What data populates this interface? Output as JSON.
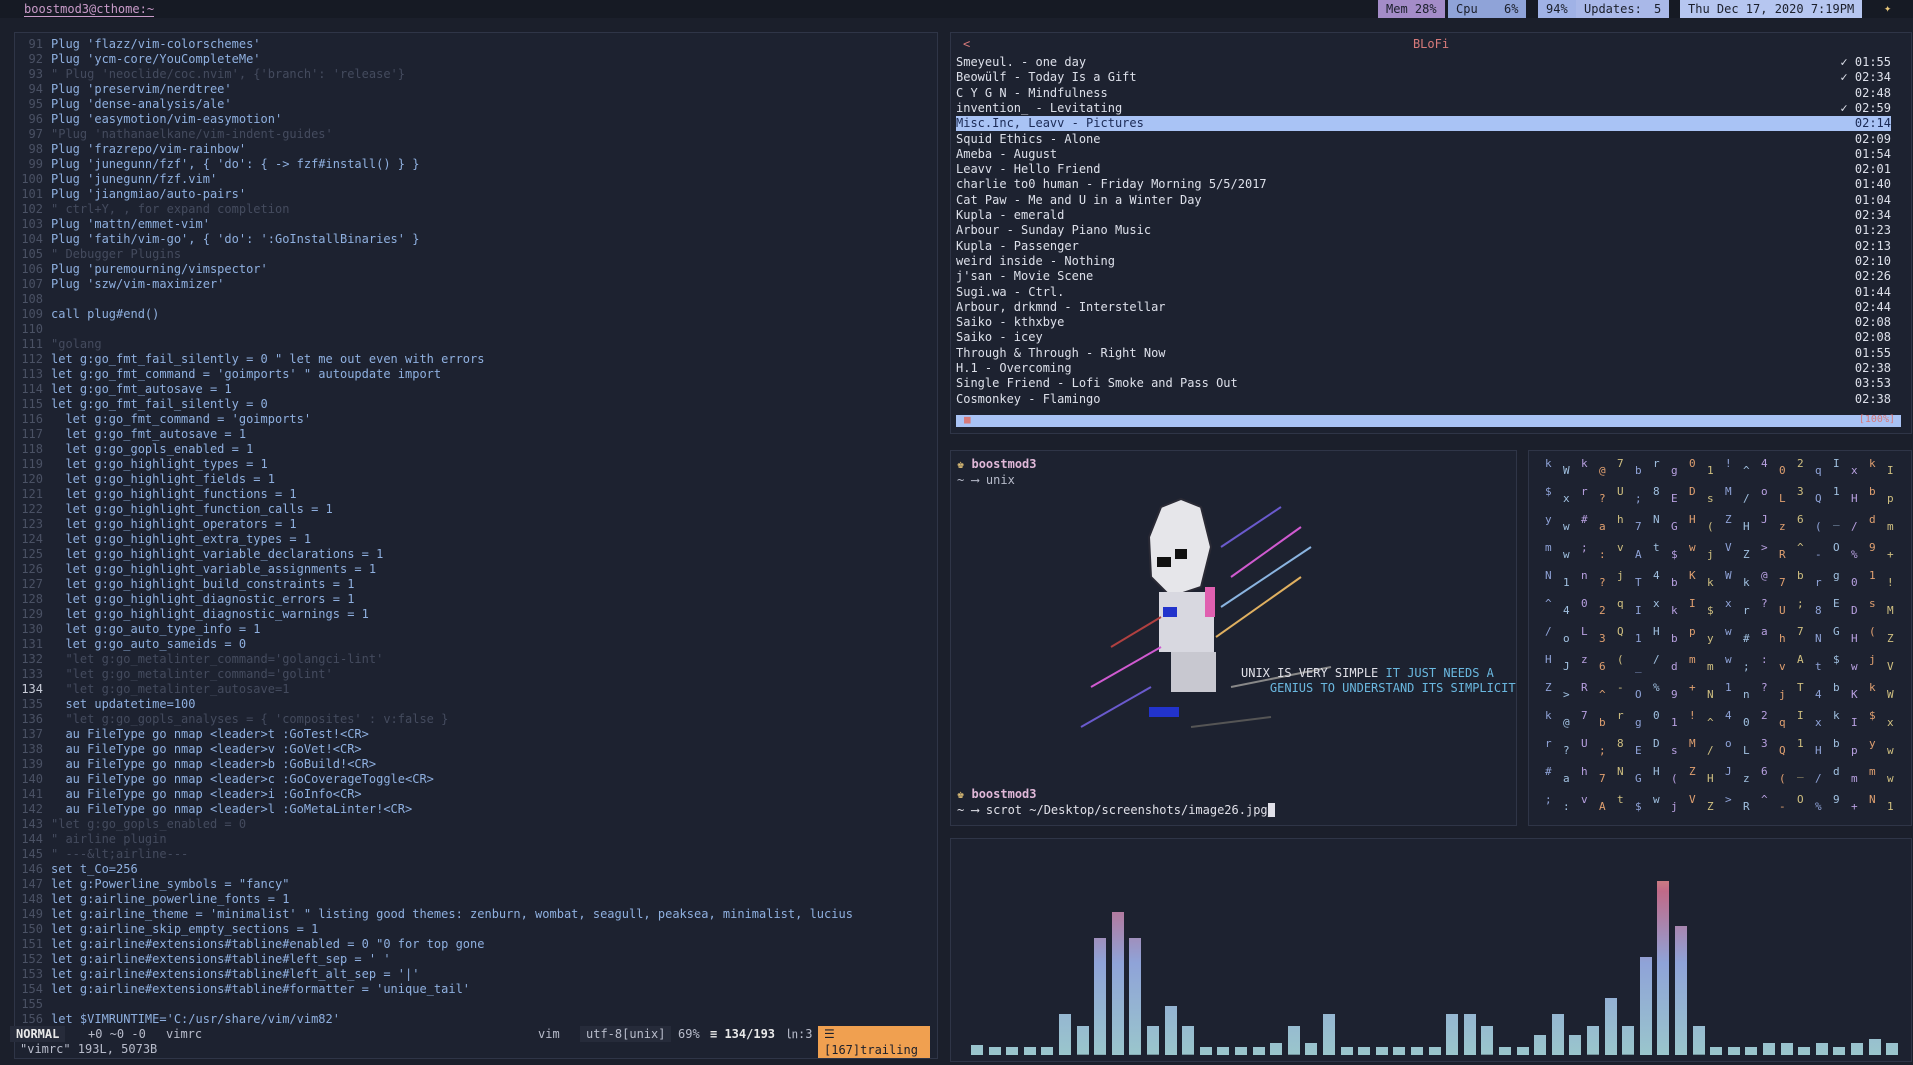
{
  "topbar": {
    "window_title": "boostmod3@cthome:~",
    "mem": "Mem 28%",
    "cpu_label": "Cpu",
    "cpu_value": "6%",
    "battery": "94%",
    "updates_label": "Updates:",
    "updates_value": "5",
    "datetime": "Thu Dec 17, 2020  7:19PM",
    "colors": {
      "mem": "#a48cc8",
      "cpu": "#8fa3d8",
      "updates": "#a9b8e8",
      "date": "#b6c6f0"
    }
  },
  "vim": {
    "lines": [
      {
        "n": "91",
        "t": "Plug 'flazz/vim-colorschemes'",
        "c": "k"
      },
      {
        "n": "92",
        "t": "Plug 'ycm-core/YouCompleteMe'",
        "c": "k"
      },
      {
        "n": "93",
        "t": "\" Plug 'neoclide/coc.nvim', {'branch': 'release'}",
        "c": "c"
      },
      {
        "n": "94",
        "t": "Plug 'preservim/nerdtree'",
        "c": "k"
      },
      {
        "n": "95",
        "t": "Plug 'dense-analysis/ale'",
        "c": "k"
      },
      {
        "n": "96",
        "t": "Plug 'easymotion/vim-easymotion'",
        "c": "k"
      },
      {
        "n": "97",
        "t": "\"Plug 'nathanaelkane/vim-indent-guides'",
        "c": "c"
      },
      {
        "n": "98",
        "t": "Plug 'frazrepo/vim-rainbow'",
        "c": "k"
      },
      {
        "n": "99",
        "t": "Plug 'junegunn/fzf', { 'do': { -> fzf#install() } }",
        "c": "k"
      },
      {
        "n": "100",
        "t": "Plug 'junegunn/fzf.vim'",
        "c": "k"
      },
      {
        "n": "101",
        "t": "Plug 'jiangmiao/auto-pairs'",
        "c": "k"
      },
      {
        "n": "102",
        "t": "\" ctrl+Y, , for expand completion",
        "c": "c"
      },
      {
        "n": "103",
        "t": "Plug 'mattn/emmet-vim'",
        "c": "k"
      },
      {
        "n": "104",
        "t": "Plug 'fatih/vim-go', { 'do': ':GoInstallBinaries' }",
        "c": "k"
      },
      {
        "n": "105",
        "t": "\" Debugger Plugins",
        "c": "c"
      },
      {
        "n": "106",
        "t": "Plug 'puremourning/vimspector'",
        "c": "k"
      },
      {
        "n": "107",
        "t": "Plug 'szw/vim-maximizer'",
        "c": "k"
      },
      {
        "n": "108",
        "t": "",
        "c": "k"
      },
      {
        "n": "109",
        "t": "call plug#end()",
        "c": "k"
      },
      {
        "n": "110",
        "t": "",
        "c": "k"
      },
      {
        "n": "111",
        "t": "\"golang",
        "c": "c"
      },
      {
        "n": "112",
        "t": "let g:go_fmt_fail_silently = 0 \" let me out even with errors",
        "c": "k"
      },
      {
        "n": "113",
        "t": "let g:go_fmt_command = 'goimports' \" autoupdate import",
        "c": "k"
      },
      {
        "n": "114",
        "t": "let g:go_fmt_autosave = 1",
        "c": "k"
      },
      {
        "n": "115",
        "t": "let g:go_fmt_fail_silently = 0",
        "c": "k"
      },
      {
        "n": "116",
        "t": "  let g:go_fmt_command = 'goimports'",
        "c": "k"
      },
      {
        "n": "117",
        "t": "  let g:go_fmt_autosave = 1",
        "c": "k"
      },
      {
        "n": "118",
        "t": "  let g:go_gopls_enabled = 1",
        "c": "k"
      },
      {
        "n": "119",
        "t": "  let g:go_highlight_types = 1",
        "c": "k"
      },
      {
        "n": "120",
        "t": "  let g:go_highlight_fields = 1",
        "c": "k"
      },
      {
        "n": "121",
        "t": "  let g:go_highlight_functions = 1",
        "c": "k"
      },
      {
        "n": "122",
        "t": "  let g:go_highlight_function_calls = 1",
        "c": "k"
      },
      {
        "n": "123",
        "t": "  let g:go_highlight_operators = 1",
        "c": "k"
      },
      {
        "n": "124",
        "t": "  let g:go_highlight_extra_types = 1",
        "c": "k"
      },
      {
        "n": "125",
        "t": "  let g:go_highlight_variable_declarations = 1",
        "c": "k"
      },
      {
        "n": "126",
        "t": "  let g:go_highlight_variable_assignments = 1",
        "c": "k"
      },
      {
        "n": "127",
        "t": "  let g:go_highlight_build_constraints = 1",
        "c": "k"
      },
      {
        "n": "128",
        "t": "  let g:go_highlight_diagnostic_errors = 1",
        "c": "k"
      },
      {
        "n": "129",
        "t": "  let g:go_highlight_diagnostic_warnings = 1",
        "c": "k"
      },
      {
        "n": "130",
        "t": "  let g:go_auto_type_info = 1",
        "c": "k"
      },
      {
        "n": "131",
        "t": "  let g:go_auto_sameids = 0",
        "c": "k"
      },
      {
        "n": "132",
        "t": "  \"let g:go_metalinter_command='golangci-lint'",
        "c": "c"
      },
      {
        "n": "133",
        "t": "  \"let g:go_metalinter_command='golint'",
        "c": "c"
      },
      {
        "n": "134",
        "t": "  \"let g:go_metalinter_autosave=1",
        "c": "c",
        "cur": true
      },
      {
        "n": "135",
        "t": "  set updatetime=100",
        "c": "k"
      },
      {
        "n": "136",
        "t": "  \"let g:go_gopls_analyses = { 'composites' : v:false }",
        "c": "c"
      },
      {
        "n": "137",
        "t": "  au FileType go nmap <leader>t :GoTest!<CR>",
        "c": "k"
      },
      {
        "n": "138",
        "t": "  au FileType go nmap <leader>v :GoVet!<CR>",
        "c": "k"
      },
      {
        "n": "139",
        "t": "  au FileType go nmap <leader>b :GoBuild!<CR>",
        "c": "k"
      },
      {
        "n": "140",
        "t": "  au FileType go nmap <leader>c :GoCoverageToggle<CR>",
        "c": "k"
      },
      {
        "n": "141",
        "t": "  au FileType go nmap <leader>i :GoInfo<CR>",
        "c": "k"
      },
      {
        "n": "142",
        "t": "  au FileType go nmap <leader>l :GoMetaLinter!<CR>",
        "c": "k"
      },
      {
        "n": "143",
        "t": "\"let g:go_gopls_enabled = 0",
        "c": "c"
      },
      {
        "n": "144",
        "t": "\" airline plugin",
        "c": "c"
      },
      {
        "n": "145",
        "t": "\" ---&lt;airline---",
        "c": "c"
      },
      {
        "n": "146",
        "t": "set t_Co=256",
        "c": "k"
      },
      {
        "n": "147",
        "t": "let g:Powerline_symbols = \"fancy\"",
        "c": "k"
      },
      {
        "n": "148",
        "t": "let g:airline_powerline_fonts = 1",
        "c": "k"
      },
      {
        "n": "149",
        "t": "let g:airline_theme = 'minimalist' \" listing good themes: zenburn, wombat, seagull, peaksea, minimalist, lucius",
        "c": "k"
      },
      {
        "n": "150",
        "t": "let g:airline_skip_empty_sections = 1",
        "c": "k"
      },
      {
        "n": "151",
        "t": "let g:airline#extensions#tabline#enabled = 0 \"0 for top gone",
        "c": "k"
      },
      {
        "n": "152",
        "t": "let g:airline#extensions#tabline#left_sep = ' '",
        "c": "k"
      },
      {
        "n": "153",
        "t": "let g:airline#extensions#tabline#left_alt_sep = '|'",
        "c": "k"
      },
      {
        "n": "154",
        "t": "let g:airline#extensions#tabline#formatter = 'unique_tail'",
        "c": "k"
      },
      {
        "n": "155",
        "t": "",
        "c": "k"
      },
      {
        "n": "156",
        "t": "let $VIMRUNTIME='C:/usr/share/vim/vim82'",
        "c": "k"
      }
    ],
    "status": {
      "mode": "NORMAL",
      "git": "+0 ~0 -0",
      "file": "vimrc",
      "filetype": "vim",
      "encoding": "utf-8[unix]",
      "percent": "69%",
      "position": "134/193",
      "column": "3",
      "warning": "[167]trailing"
    },
    "cmdline": "\"vimrc\" 193L, 5073B"
  },
  "music": {
    "title": "BLoFi",
    "back": "<",
    "tracks": [
      {
        "name": "Smeyeul. - one day",
        "dur": "✓ 01:55"
      },
      {
        "name": "Beowülf - Today Is a Gift",
        "dur": "✓ 02:34"
      },
      {
        "name": "C Y G N - Mindfulness",
        "dur": "02:48"
      },
      {
        "name": "invention_ - Levitating",
        "dur": "✓ 02:59"
      },
      {
        "name": "Misc.Inc, Leavv - Pictures",
        "dur": "02:14",
        "sel": true
      },
      {
        "name": "Squid Ethics - Alone",
        "dur": "02:09"
      },
      {
        "name": "Ameba - August",
        "dur": "01:54"
      },
      {
        "name": "Leavv - Hello Friend",
        "dur": "02:01"
      },
      {
        "name": "charlie to0 human - Friday Morning 5/5/2017",
        "dur": "01:40"
      },
      {
        "name": "Cat Paw - Me and U in a Winter Day",
        "dur": "01:04"
      },
      {
        "name": "Kupla - emerald",
        "dur": "02:34"
      },
      {
        "name": "Arbour - Sunday Piano Music",
        "dur": "01:23"
      },
      {
        "name": "Kupla - Passenger",
        "dur": "02:13"
      },
      {
        "name": "weird inside - Nothing",
        "dur": "02:10"
      },
      {
        "name": "j'san - Movie Scene",
        "dur": "02:26"
      },
      {
        "name": "Sugi.wa - Ctrl.",
        "dur": "01:44"
      },
      {
        "name": "Arbour, drkmnd - Interstellar",
        "dur": "02:44"
      },
      {
        "name": "Saiko - kthxbye",
        "dur": "02:08"
      },
      {
        "name": "Saiko - icey",
        "dur": "02:08"
      },
      {
        "name": "Through & Through - Right Now",
        "dur": "01:55"
      },
      {
        "name": "H.1 - Overcoming",
        "dur": "02:38"
      },
      {
        "name": "Single Friend - Lofi Smoke and Pass Out",
        "dur": "03:53"
      },
      {
        "name": "Cosmonkey - Flamingo",
        "dur": "02:38"
      }
    ],
    "progress_left": "■",
    "progress_right": "[100%]"
  },
  "terminal": {
    "user": "boostmod3",
    "cmd1": "~ ⟶ unix",
    "quote_a": "UNIX IS VERY SIMPLE",
    "quote_b": "IT JUST NEEDS A",
    "quote_c": "GENIUS TO UNDERSTAND ITS SIMPLICITY",
    "user2": "boostmod3",
    "cmd2": "~ ⟶ scrot ~/Desktop/screenshots/image26.jpg"
  },
  "visualizer": {
    "levels": [
      0.05,
      0.04,
      0.04,
      0.04,
      0.04,
      0.2,
      0.14,
      0.57,
      0.7,
      0.57,
      0.14,
      0.24,
      0.14,
      0.04,
      0.04,
      0.04,
      0.04,
      0.06,
      0.14,
      0.06,
      0.2,
      0.04,
      0.04,
      0.04,
      0.04,
      0.04,
      0.04,
      0.2,
      0.2,
      0.14,
      0.04,
      0.04,
      0.1,
      0.2,
      0.1,
      0.14,
      0.28,
      0.14,
      0.48,
      0.85,
      0.63,
      0.14,
      0.04,
      0.04,
      0.04,
      0.06,
      0.06,
      0.04,
      0.06,
      0.04,
      0.06,
      0.08,
      0.06
    ]
  }
}
